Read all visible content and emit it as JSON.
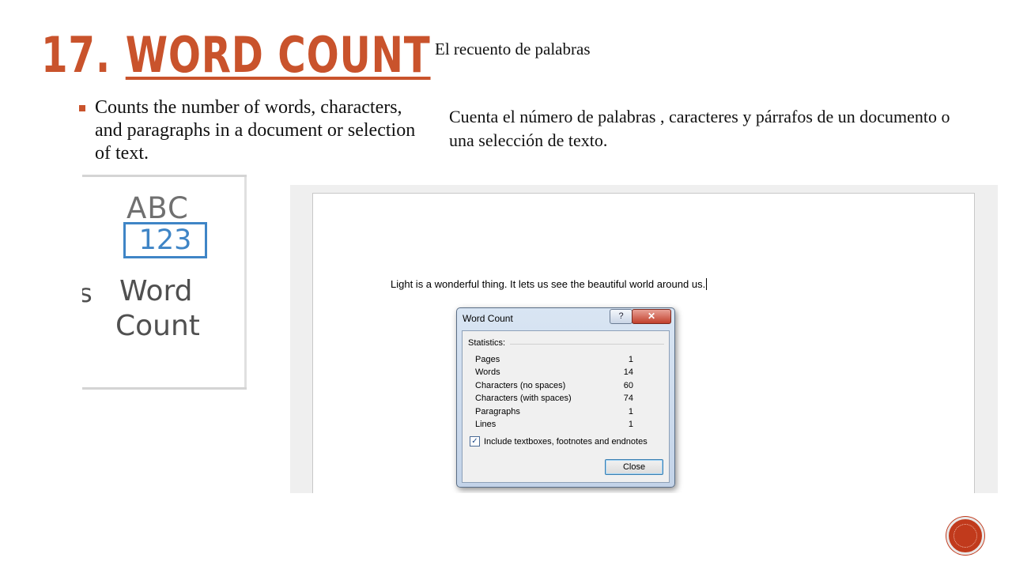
{
  "slide": {
    "title_number": "17.",
    "title_text": "WORD  COUNT",
    "spanish_heading": "El recuento de palabras",
    "bullet_text": "Counts the number of words, characters, and paragraphs in a document or selection of text.",
    "spanish_description": "Cuenta el número de palabras , caracteres y párrafos de un documento o una selección de texto.",
    "accent_color": "#c9532c"
  },
  "ribbon": {
    "icon_top": "ABC",
    "icon_boxed": "123",
    "partial_left_text": "s",
    "label_line1": "Word",
    "label_line2": "Count",
    "icon_color": "#3f85c6"
  },
  "document": {
    "text": "Light is a wonderful thing.  It lets us see the beautiful world around us."
  },
  "dialog": {
    "title": "Word Count",
    "help_button": "?",
    "close_x": "✕",
    "section_label": "Statistics:",
    "stats": [
      {
        "label": "Pages",
        "value": "1"
      },
      {
        "label": "Words",
        "value": "14"
      },
      {
        "label": "Characters (no spaces)",
        "value": "60"
      },
      {
        "label": "Characters (with spaces)",
        "value": "74"
      },
      {
        "label": "Paragraphs",
        "value": "1"
      },
      {
        "label": "Lines",
        "value": "1"
      }
    ],
    "checkbox_label": "Include textboxes, footnotes and endnotes",
    "checkbox_checked": true,
    "checkbox_mark": "✓",
    "close_button": "Close"
  },
  "nav": {
    "icon": "next-slide-circle-icon",
    "color": "#c13a1c"
  }
}
